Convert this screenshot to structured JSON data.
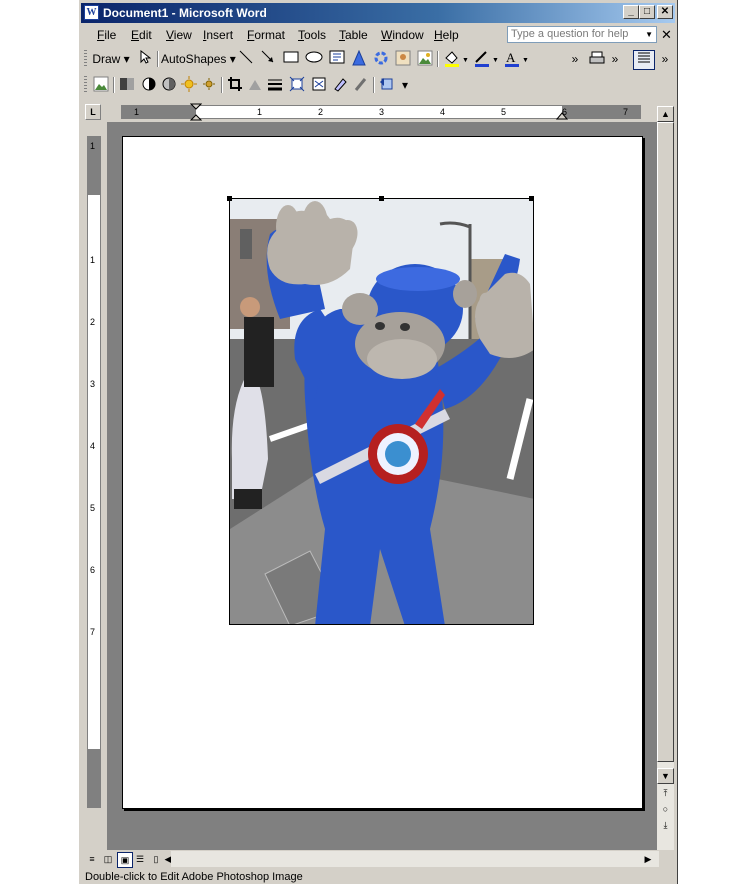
{
  "window": {
    "title": "Document1 - Microsoft Word",
    "app_icon": "W"
  },
  "caption_buttons": {
    "minimize": "_",
    "maximize": "□",
    "close": "✕"
  },
  "menubar": {
    "items": [
      "File",
      "Edit",
      "View",
      "Insert",
      "Format",
      "Tools",
      "Table",
      "Window",
      "Help"
    ],
    "help_placeholder": "Type a question for help",
    "close_doc": "✕"
  },
  "drawing_toolbar": {
    "draw_label": "Draw ▾",
    "autoshapes_label": "AutoShapes ▾"
  },
  "ruler": {
    "h_ticks": [
      "1",
      "1",
      "2",
      "3",
      "4",
      "5",
      "6",
      "7"
    ],
    "v_ticks": [
      "1",
      "1",
      "2",
      "3",
      "4",
      "5",
      "6",
      "7"
    ],
    "tab_glyph": "L"
  },
  "status": {
    "text": "Double-click to Edit Adobe Photoshop Image"
  },
  "colors": {
    "titlebar_start": "#0a246a",
    "titlebar_end": "#a6caf0",
    "chrome": "#d4d0c8",
    "workspace": "#808080",
    "mascot_blue": "#2a57c9"
  }
}
